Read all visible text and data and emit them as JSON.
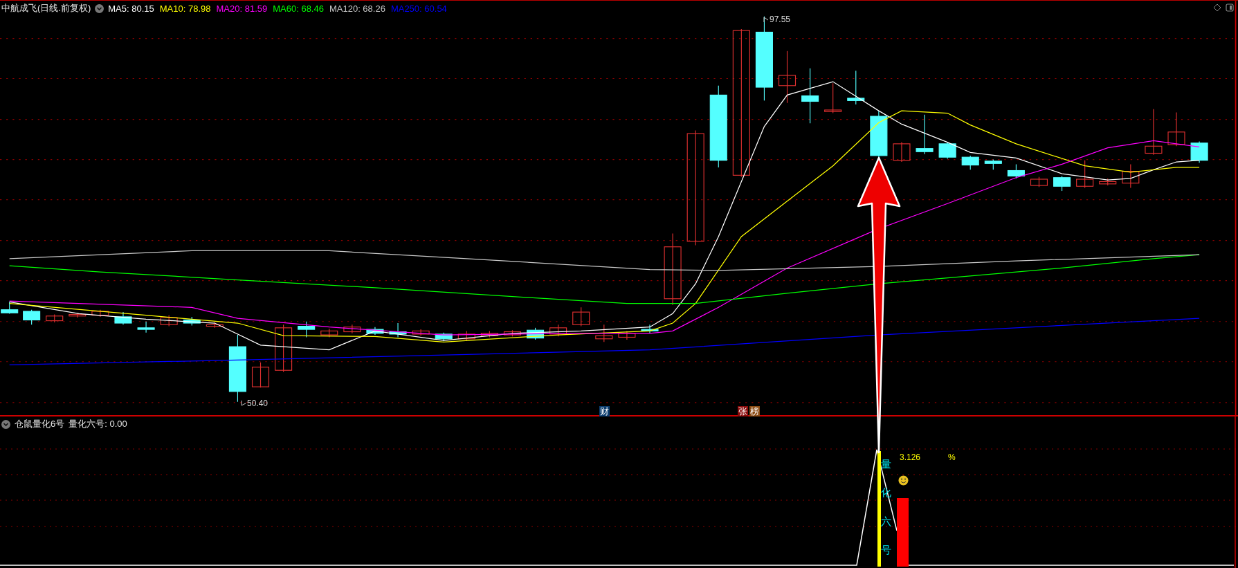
{
  "header": {
    "title": "中航成飞(日线.前复权)",
    "indicators": [
      {
        "label": "MA5: 80.15",
        "color": "#ffffff"
      },
      {
        "label": "MA10: 78.98",
        "color": "#ffff00"
      },
      {
        "label": "MA20: 81.59",
        "color": "#ff00ff"
      },
      {
        "label": "MA60: 68.46",
        "color": "#00ff00"
      },
      {
        "label": "MA120: 68.26",
        "color": "#c8c8c8"
      },
      {
        "label": "MA250: 60.54",
        "color": "#0000ff"
      }
    ]
  },
  "price_labels": [
    {
      "kind": "high",
      "text": "97.55"
    },
    {
      "kind": "low",
      "text": "50.40"
    }
  ],
  "event_markers": [
    {
      "text": "财",
      "color": "#0b3c6e"
    },
    {
      "text": "张",
      "color": "#8b0a0a"
    },
    {
      "text": "榜",
      "color": "#8b4a12"
    }
  ],
  "indicator_panel": {
    "title": "仓鼠量化6号",
    "value_label": "量化六号: 0.00",
    "vertical_text": "量化六号",
    "reading": "3.126",
    "unit": "%"
  }
}
